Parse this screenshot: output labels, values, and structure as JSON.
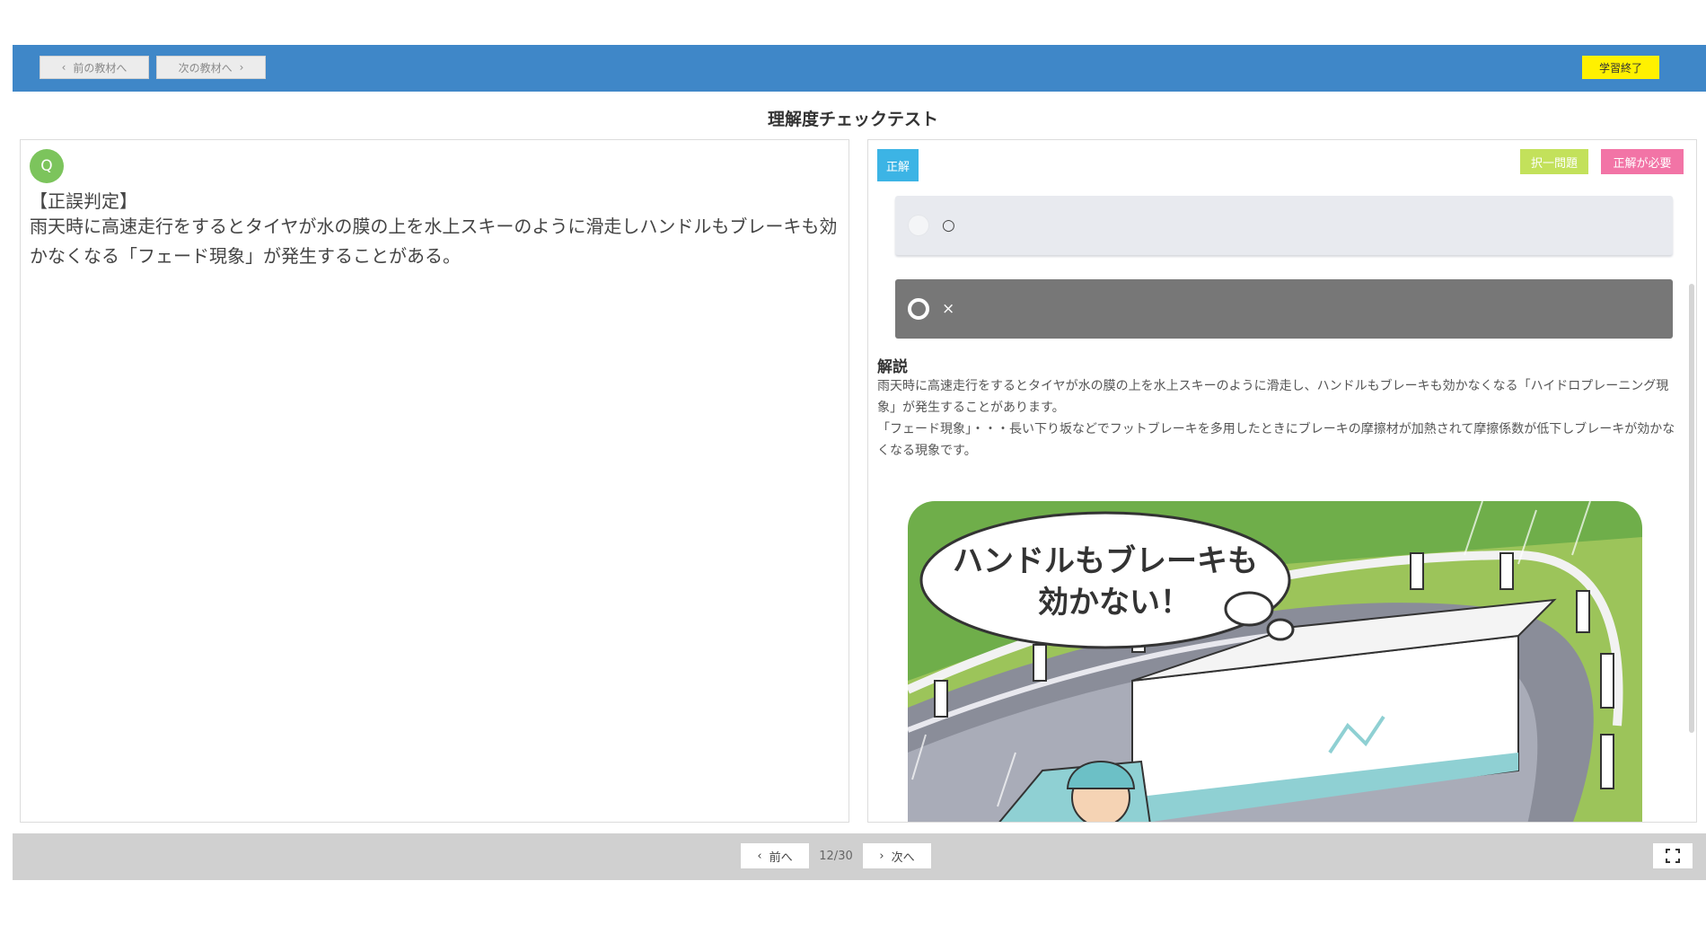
{
  "topbar": {
    "prev_label": "前の教材へ",
    "next_label": "次の教材へ",
    "finish_label": "学習終了",
    "bg_color": "#3f87c8"
  },
  "page_title": "理解度チェックテスト",
  "question": {
    "badge": "Q",
    "tag": "【正誤判定】",
    "text": "雨天時に高速走行をするとタイヤが水の膜の上を水上スキーのように滑走しハンドルもブレーキも効かなくなる「フェード現象」が発生することがある。"
  },
  "answer_panel": {
    "result_label": "正解",
    "select_label": "択一問題",
    "need_label": "正解が必要",
    "choices": [
      {
        "label": "○",
        "selected": false
      },
      {
        "label": "×",
        "selected": true
      }
    ],
    "explanation_heading": "解説",
    "explanation_lines": [
      "雨天時に高速走行をするとタイヤが水の膜の上を水上スキーのように滑走し、ハンドルもブレーキも効かなくなる「ハイドロプレーニング現象」が発生することがあります。",
      "「フェード現象」・・・長い下り坂などでフットブレーキを多用したときにブレーキの摩擦材が加熱されて摩擦係数が低下しブレーキが効かなくなる現象です。"
    ],
    "illustration": {
      "speech_line1": "ハンドルもブレーキも",
      "speech_line2": "効かない！"
    }
  },
  "pager": {
    "prev_label": "前へ",
    "count": "12/30",
    "next_label": "次へ"
  }
}
